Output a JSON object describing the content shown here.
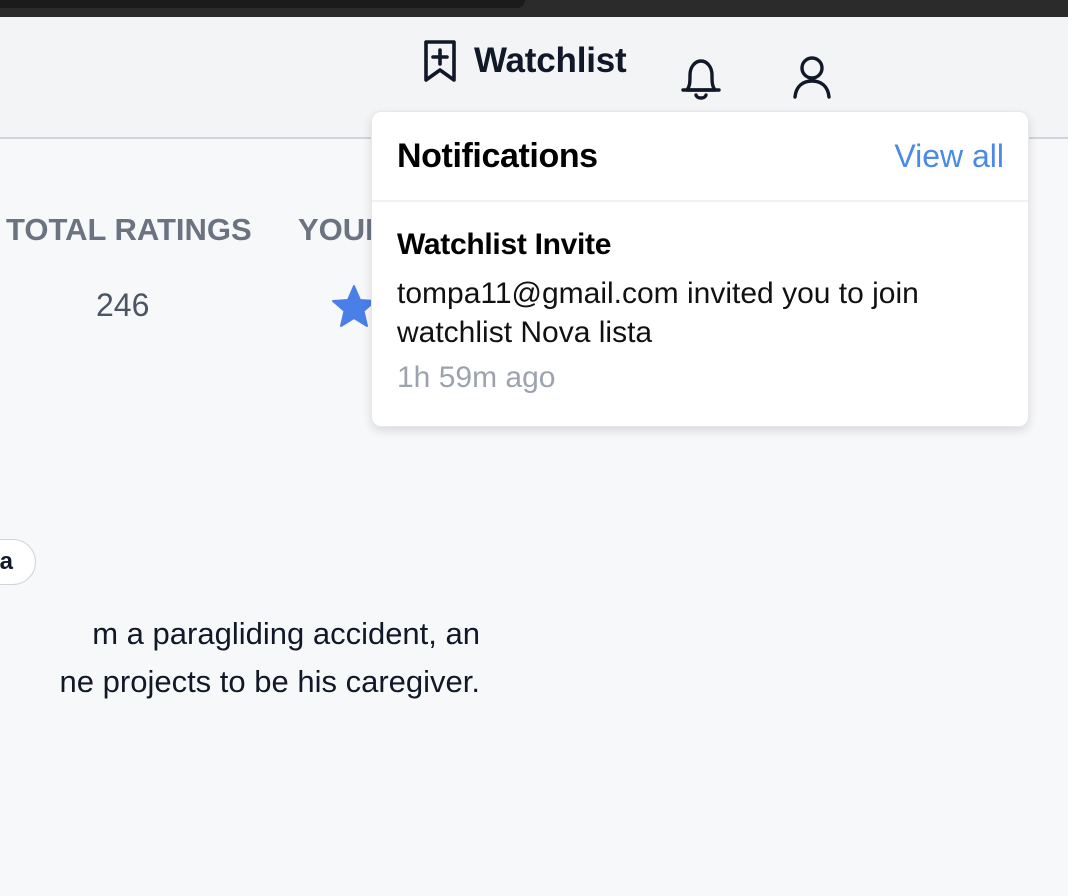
{
  "header": {
    "watchlist_label": "Watchlist"
  },
  "stats": {
    "total_ratings_label": "TOTAL RATINGS",
    "total_ratings_value": "246",
    "your_rating_label_visible": "YOUR"
  },
  "movie": {
    "genre_chip_visible": "a",
    "synopsis_visible": "m a paragliding accident, an\nne projects to be his caregiver."
  },
  "notifications": {
    "title": "Notifications",
    "view_all": "View all",
    "items": [
      {
        "title": "Watchlist Invite",
        "body": "tompa11@gmail.com invited you to join watchlist Nova lista",
        "time": "1h 59m ago"
      }
    ]
  },
  "colors": {
    "accent": "#4a8ae6",
    "star": "#4a7fe8",
    "text_muted": "#6b7280",
    "background": "#f7f8fa"
  },
  "icons": {
    "watchlist": "bookmark-plus-icon",
    "notifications": "bell-icon",
    "profile": "user-icon",
    "rating": "star-icon"
  }
}
